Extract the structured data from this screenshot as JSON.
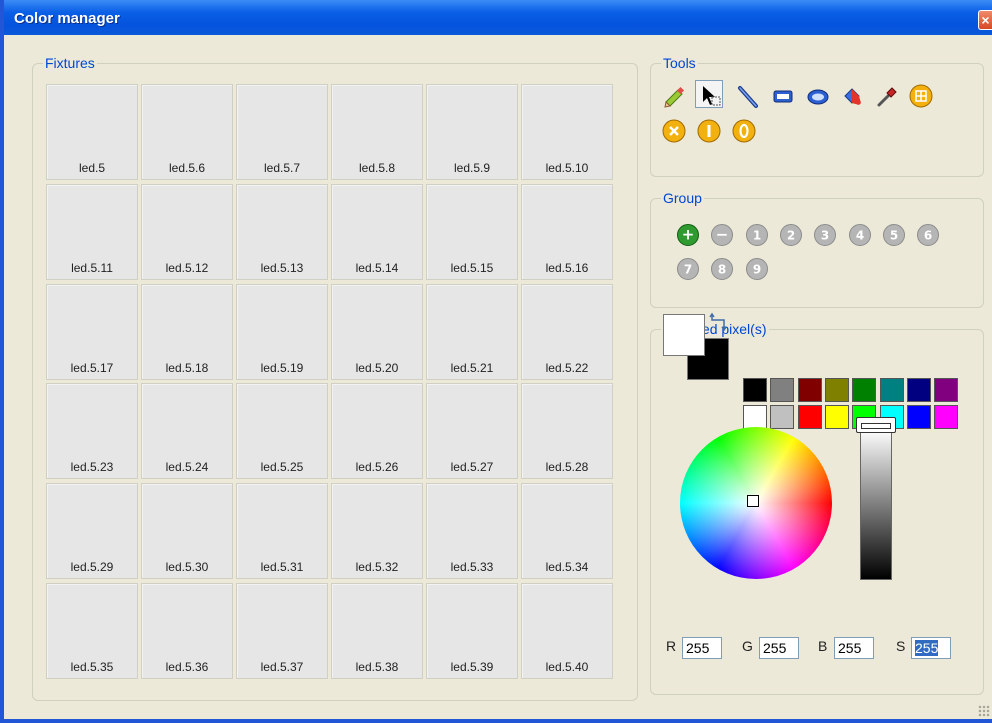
{
  "window": {
    "title": "Color manager",
    "close_label": "×"
  },
  "fixtures": {
    "legend": "Fixtures",
    "items": [
      "led.5",
      "led.5.6",
      "led.5.7",
      "led.5.8",
      "led.5.9",
      "led.5.10",
      "led.5.11",
      "led.5.12",
      "led.5.13",
      "led.5.14",
      "led.5.15",
      "led.5.16",
      "led.5.17",
      "led.5.18",
      "led.5.19",
      "led.5.20",
      "led.5.21",
      "led.5.22",
      "led.5.23",
      "led.5.24",
      "led.5.25",
      "led.5.26",
      "led.5.27",
      "led.5.28",
      "led.5.29",
      "led.5.30",
      "led.5.31",
      "led.5.32",
      "led.5.33",
      "led.5.34",
      "led.5.35",
      "led.5.36",
      "led.5.37",
      "led.5.38",
      "led.5.39",
      "led.5.40"
    ]
  },
  "tools": {
    "legend": "Tools",
    "icons": [
      "pencil-icon",
      "select-arrow-icon",
      "line-icon",
      "rectangle-icon",
      "ellipse-icon",
      "fill-bucket-icon",
      "eyedropper-icon",
      "grid-icon",
      "close-circle-icon",
      "info-circle-icon",
      "zero-circle-icon"
    ],
    "selected": "select-arrow-icon"
  },
  "group": {
    "legend": "Group",
    "labels": [
      "+",
      "−",
      "1",
      "2",
      "3",
      "4",
      "5",
      "6",
      "7",
      "8",
      "9"
    ]
  },
  "selected_pixels": {
    "legend": "Selected pixel(s)",
    "foreground": "#ffffff",
    "background": "#000000",
    "palette_top": [
      "#000000",
      "#808080",
      "#800000",
      "#808000",
      "#008000",
      "#008080",
      "#000080",
      "#800080"
    ],
    "palette_bottom": [
      "#ffffff",
      "#c0c0c0",
      "#ff0000",
      "#ffff00",
      "#00ff00",
      "#00ffff",
      "#0000ff",
      "#ff00ff"
    ],
    "brightness": 1.0,
    "channels": [
      {
        "label": "R",
        "value": "255"
      },
      {
        "label": "G",
        "value": "255"
      },
      {
        "label": "B",
        "value": "255"
      },
      {
        "label": "S",
        "value": "255"
      }
    ]
  }
}
